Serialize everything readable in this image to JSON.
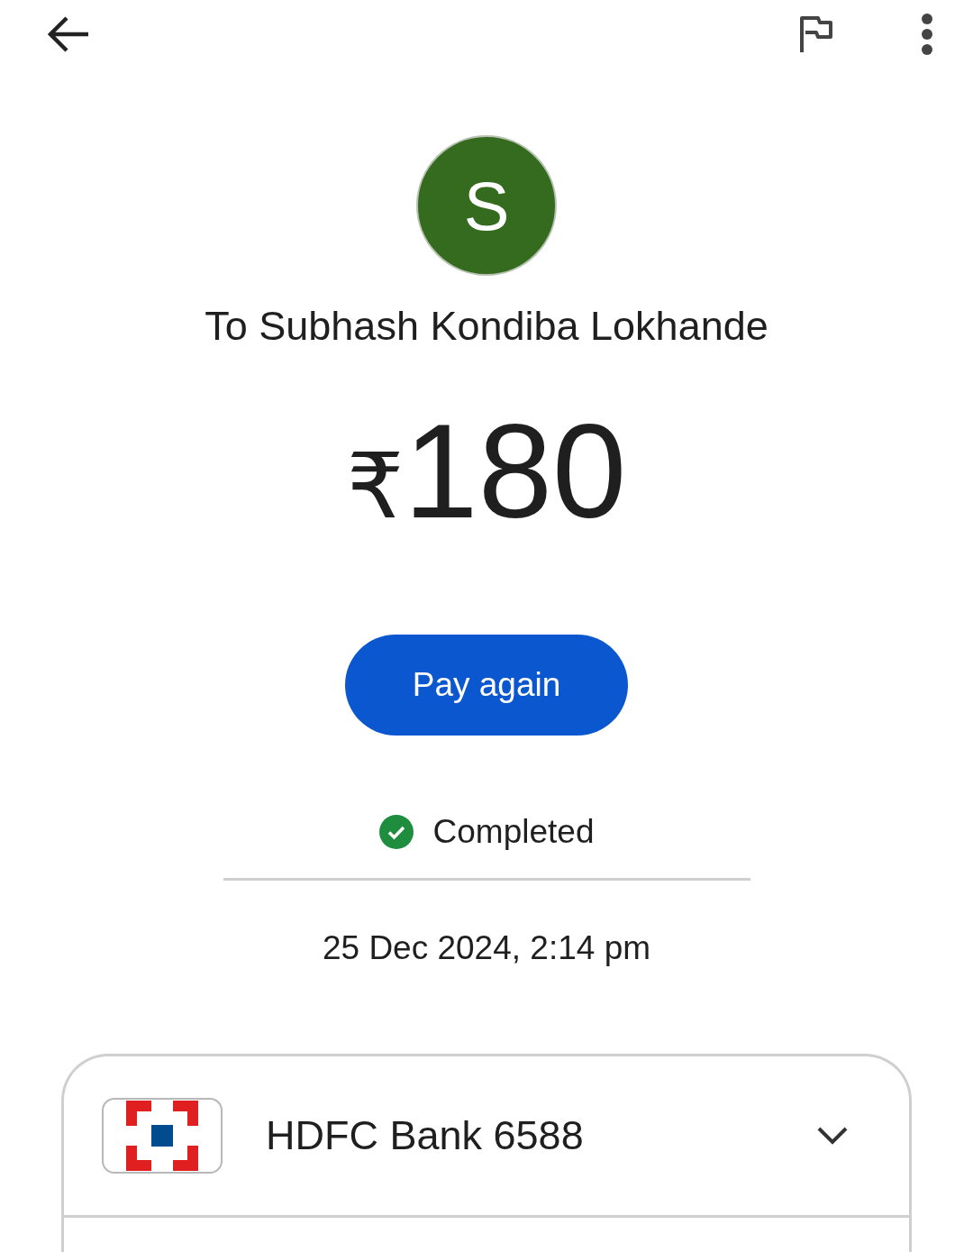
{
  "payee": {
    "initial": "S",
    "name": "To Subhash Kondiba Lokhande"
  },
  "amount": {
    "currency": "₹",
    "value": "180"
  },
  "pay_button": {
    "label": "Pay again"
  },
  "status": {
    "kind": "success",
    "label": "Completed"
  },
  "date": "25 Dec 2024, 2:14 pm",
  "account": {
    "label": "HDFC Bank 6588",
    "expanded": false
  }
}
